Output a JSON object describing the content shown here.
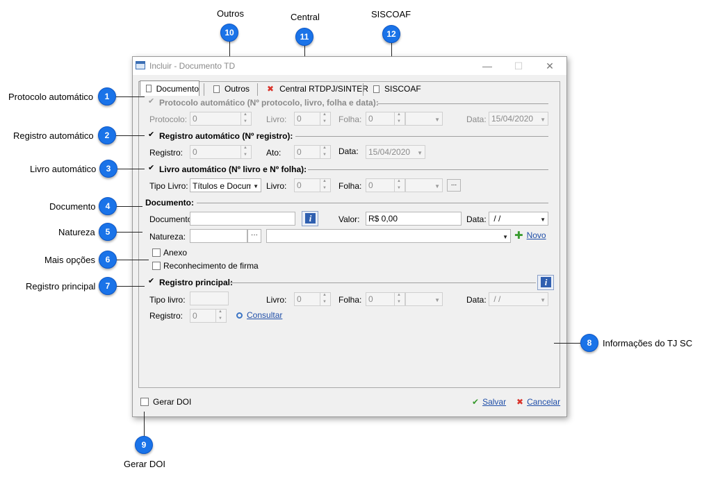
{
  "window": {
    "title": "Incluir - Documento TD",
    "minimize": "—",
    "maximize": "☐",
    "close": "✕"
  },
  "tabs": [
    {
      "label": "Documento",
      "icon": "document-icon"
    },
    {
      "label": "Outros",
      "icon": "document-icon"
    },
    {
      "label": "Central RTDPJ/SINTER",
      "icon": "x-icon"
    },
    {
      "label": "SISCOAF",
      "icon": "document-icon"
    }
  ],
  "protocolo": {
    "title": "Protocolo automático (Nº protocolo, livro, folha e data):",
    "protocolo_label": "Protocolo:",
    "protocolo_value": "0",
    "livro_label": "Livro:",
    "livro_value": "0",
    "folha_label": "Folha:",
    "folha_value": "0",
    "data_label": "Data:",
    "data_value": "15/04/2020"
  },
  "registro_auto": {
    "title": "Registro automático (Nº registro):",
    "registro_label": "Registro:",
    "registro_value": "0",
    "ato_label": "Ato:",
    "ato_value": "0",
    "data_label": "Data:",
    "data_value": "15/04/2020"
  },
  "livro_auto": {
    "title": "Livro automático (Nº livro e Nº folha):",
    "tipo_label": "Tipo Livro:",
    "tipo_value": "Títulos e Docume",
    "livro_label": "Livro:",
    "livro_value": "0",
    "folha_label": "Folha:",
    "folha_value": "0",
    "more_button": "..."
  },
  "documento": {
    "title": "Documento:",
    "documento_label": "Documento:",
    "documento_value": "",
    "valor_label": "Valor:",
    "valor_value": "R$ 0,00",
    "data_label": "Data:",
    "data_value": " / /",
    "natureza_label": "Natureza:",
    "natureza_dots": "···",
    "novo_label": "Novo",
    "anexo_label": "Anexo",
    "reconhecimento_label": "Reconhecimento de firma"
  },
  "registro_principal": {
    "title": "Registro principal:",
    "tipo_label": "Tipo livro:",
    "livro_label": "Livro:",
    "livro_value": "0",
    "folha_label": "Folha:",
    "folha_value": "0",
    "data_label": "Data:",
    "data_value": " / /",
    "registro_label": "Registro:",
    "registro_value": "0",
    "consultar_label": "Consultar"
  },
  "footer": {
    "gerar_doi_label": "Gerar DOI",
    "salvar_label": "Salvar",
    "cancelar_label": "Cancelar"
  },
  "callouts": [
    {
      "number": "1",
      "label": "Protocolo automático"
    },
    {
      "number": "2",
      "label": "Registro automático"
    },
    {
      "number": "3",
      "label": "Livro automático"
    },
    {
      "number": "4",
      "label": "Documento"
    },
    {
      "number": "5",
      "label": "Natureza"
    },
    {
      "number": "6",
      "label": "Mais opções"
    },
    {
      "number": "7",
      "label": "Registro principal"
    },
    {
      "number": "8",
      "label": "Informações do TJ SC"
    },
    {
      "number": "9",
      "label": "Gerar DOI"
    },
    {
      "number": "10",
      "label": "Outros"
    },
    {
      "number": "11",
      "label": "Central"
    },
    {
      "number": "12",
      "label": "SISCOAF"
    }
  ],
  "colors": {
    "badge": "#1a73e8",
    "link": "#1f4ea8",
    "ok_green": "#3a9b2f",
    "cancel_red": "#d9342b"
  }
}
